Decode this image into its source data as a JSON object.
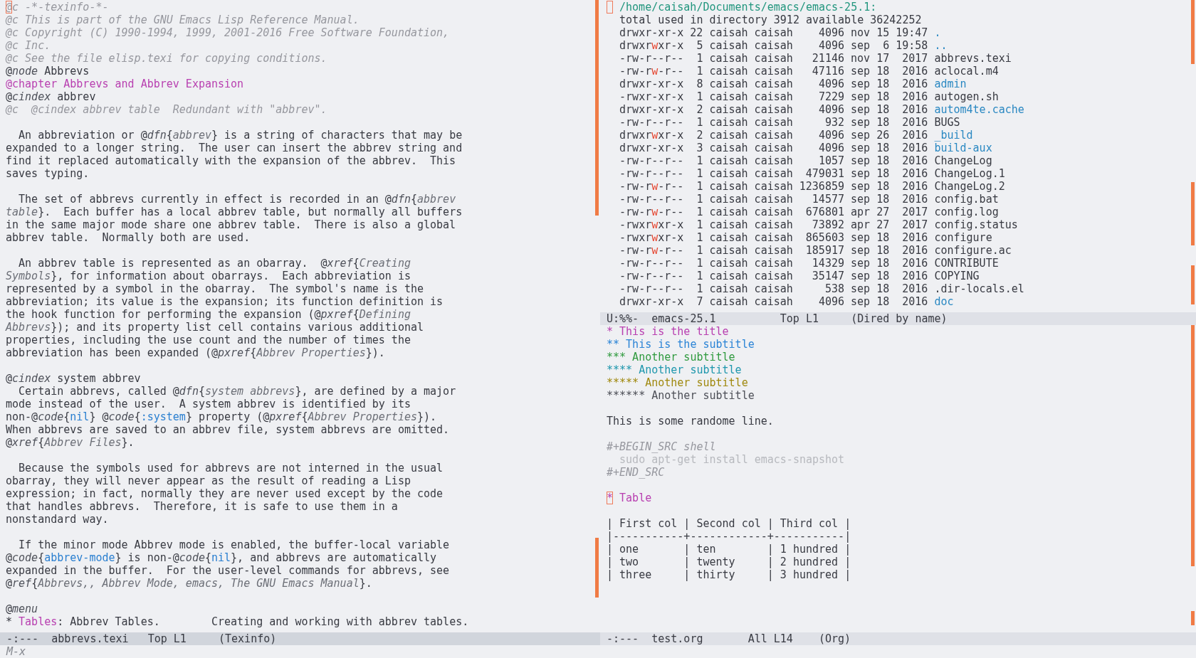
{
  "windows": [
    {
      "kind": "texinfo",
      "blocks": [
        [
          [
            {
              "text": "@c -*-texinfo-*-",
              "kind": "comment_at_cursor"
            }
          ],
          [
            {
              "text": "@c This is part of the GNU Emacs Lisp Reference Manual.",
              "kind": "comment"
            }
          ],
          [
            {
              "text": "@c Copyright (C) 1990-1994, 1999, 2001-2016 Free Software Foundation,",
              "kind": "comment"
            }
          ],
          [
            {
              "text": "@c Inc.",
              "kind": "comment"
            }
          ],
          [
            {
              "text": "@c See the file elisp.texi for copying conditions.",
              "kind": "comment"
            }
          ],
          [
            {
              "text": "@"
            },
            {
              "text": "node",
              "kind": "keyword"
            },
            {
              "text": " Abbrevs"
            }
          ],
          [
            {
              "text": "@chapter Abbrevs and Abbrev Expansion",
              "kind": "chapter"
            }
          ],
          [
            {
              "text": "@"
            },
            {
              "text": "cindex",
              "kind": "keyword"
            },
            {
              "text": " abbrev"
            }
          ],
          [
            {
              "text": "@c  @cindex abbrev table  Redundant with \"abbrev\".",
              "kind": "comment"
            }
          ]
        ],
        [
          [
            {
              "text": "  An abbreviation or @"
            },
            {
              "text": "dfn",
              "kind": "keyword"
            },
            {
              "text": "{"
            },
            {
              "text": "abbrev",
              "kind": "argument"
            },
            {
              "text": "} is a string of characters that may be"
            }
          ],
          [
            {
              "text": "expanded to a longer string.  The user can insert the abbrev string and"
            }
          ],
          [
            {
              "text": "find it replaced automatically with the expansion of the abbrev.  This"
            }
          ],
          [
            {
              "text": "saves typing."
            }
          ]
        ],
        [
          [
            {
              "text": "  The set of abbrevs currently in effect is recorded in an @"
            },
            {
              "text": "dfn",
              "kind": "keyword"
            },
            {
              "text": "{"
            },
            {
              "text": "abbrev",
              "kind": "argument"
            }
          ],
          [
            {
              "text": "table",
              "kind": "argument"
            },
            {
              "text": "}.  Each buffer has a local abbrev table, but normally all buffers"
            }
          ],
          [
            {
              "text": "in the same major mode share one abbrev table.  There is also a global"
            }
          ],
          [
            {
              "text": "abbrev table.  Normally both are used."
            }
          ]
        ],
        [
          [
            {
              "text": "  An abbrev table is represented as an obarray.  @"
            },
            {
              "text": "xref",
              "kind": "keyword"
            },
            {
              "text": "{"
            },
            {
              "text": "Creating",
              "kind": "argument"
            }
          ],
          [
            {
              "text": "Symbols",
              "kind": "argument"
            },
            {
              "text": "}, for information about obarrays.  Each abbreviation is"
            }
          ],
          [
            {
              "text": "represented by a symbol in the obarray.  The symbol's name is the"
            }
          ],
          [
            {
              "text": "abbreviation; its value is the expansion; its function definition is"
            }
          ],
          [
            {
              "text": "the hook function for performing the expansion (@"
            },
            {
              "text": "pxref",
              "kind": "keyword"
            },
            {
              "text": "{"
            },
            {
              "text": "Defining",
              "kind": "argument"
            }
          ],
          [
            {
              "text": "Abbrevs",
              "kind": "argument"
            },
            {
              "text": "}); and its property list cell contains various additional"
            }
          ],
          [
            {
              "text": "properties, including the use count and the number of times the"
            }
          ],
          [
            {
              "text": "abbreviation has been expanded (@"
            },
            {
              "text": "pxref",
              "kind": "keyword"
            },
            {
              "text": "{"
            },
            {
              "text": "Abbrev Properties",
              "kind": "argument"
            },
            {
              "text": "})."
            }
          ]
        ],
        [
          [
            {
              "text": "@"
            },
            {
              "text": "cindex",
              "kind": "keyword"
            },
            {
              "text": " system abbrev"
            }
          ],
          [
            {
              "text": "  Certain abbrevs, called @"
            },
            {
              "text": "dfn",
              "kind": "keyword"
            },
            {
              "text": "{"
            },
            {
              "text": "system abbrevs",
              "kind": "argument"
            },
            {
              "text": "}, are defined by a major"
            }
          ],
          [
            {
              "text": "mode instead of the user.  A system abbrev is identified by its"
            }
          ],
          [
            {
              "text": "non-@"
            },
            {
              "text": "code",
              "kind": "keyword"
            },
            {
              "text": "{"
            },
            {
              "text": "nil",
              "kind": "code"
            },
            {
              "text": "} @"
            },
            {
              "text": "code",
              "kind": "keyword"
            },
            {
              "text": "{"
            },
            {
              "text": ":system",
              "kind": "code"
            },
            {
              "text": "} property (@"
            },
            {
              "text": "pxref",
              "kind": "keyword"
            },
            {
              "text": "{"
            },
            {
              "text": "Abbrev Properties",
              "kind": "argument"
            },
            {
              "text": "})."
            }
          ],
          [
            {
              "text": "When abbrevs are saved to an abbrev file, system abbrevs are omitted."
            }
          ],
          [
            {
              "text": "@"
            },
            {
              "text": "xref",
              "kind": "keyword"
            },
            {
              "text": "{"
            },
            {
              "text": "Abbrev Files",
              "kind": "argument"
            },
            {
              "text": "}."
            }
          ]
        ],
        [
          [
            {
              "text": "  Because the symbols used for abbrevs are not interned in the usual"
            }
          ],
          [
            {
              "text": "obarray, they will never appear as the result of reading a Lisp"
            }
          ],
          [
            {
              "text": "expression; in fact, normally they are never used except by the code"
            }
          ],
          [
            {
              "text": "that handles abbrevs.  Therefore, it is safe to use them in a"
            }
          ],
          [
            {
              "text": "nonstandard way."
            }
          ]
        ],
        [
          [
            {
              "text": "  If the minor mode Abbrev mode is enabled, the buffer-local variable"
            }
          ],
          [
            {
              "text": "@"
            },
            {
              "text": "code",
              "kind": "keyword"
            },
            {
              "text": "{"
            },
            {
              "text": "abbrev-mode",
              "kind": "code"
            },
            {
              "text": "} is non-@"
            },
            {
              "text": "code",
              "kind": "keyword"
            },
            {
              "text": "{"
            },
            {
              "text": "nil",
              "kind": "code"
            },
            {
              "text": "}, and abbrevs are automatically"
            }
          ],
          [
            {
              "text": "expanded in the buffer.  For the user-level commands for abbrevs, see"
            }
          ],
          [
            {
              "text": "@"
            },
            {
              "text": "ref",
              "kind": "keyword"
            },
            {
              "text": "{"
            },
            {
              "text": "Abbrevs,, Abbrev Mode, emacs, The GNU Emacs Manual",
              "kind": "argument"
            },
            {
              "text": "}."
            }
          ]
        ],
        [
          [
            {
              "text": "@"
            },
            {
              "text": "menu",
              "kind": "keyword"
            }
          ],
          [
            {
              "text": "* "
            },
            {
              "text": "Tables",
              "kind": "menu"
            },
            {
              "text": ": Abbrev Tables.        Creating and working with abbrev tables."
            }
          ]
        ]
      ],
      "mode_line": {
        "active": true,
        "status": "-:---",
        "buffer": "abbrevs.texi",
        "position": "Top L1",
        "mode": "(Texinfo)"
      }
    },
    {
      "kind": "dired",
      "header": {
        "cursor": true,
        "path": "/home/caisah/Documents/emacs/emacs-25.1:"
      },
      "summary": "total used in directory 3912 available 36242252",
      "entries": [
        {
          "kind": "directory",
          "permissions": "drwxr-xr-x",
          "group_writable": false,
          "links": "22",
          "owner": "caisah",
          "group": "caisah",
          "size": "4096",
          "date": "nov 15 19:47",
          "name": "."
        },
        {
          "kind": "directory",
          "permissions": "drwxrwxr-x",
          "group_writable": true,
          "links": "5",
          "owner": "caisah",
          "group": "caisah",
          "size": "4096",
          "date": "sep  6 19:58",
          "name": ".."
        },
        {
          "kind": "file",
          "permissions": "-rw-r--r--",
          "group_writable": false,
          "links": "1",
          "owner": "caisah",
          "group": "caisah",
          "size": "21146",
          "date": "nov 17  2017",
          "name": "abbrevs.texi"
        },
        {
          "kind": "file",
          "permissions": "-rw-rw-r--",
          "group_writable": true,
          "links": "1",
          "owner": "caisah",
          "group": "caisah",
          "size": "47116",
          "date": "sep 18  2016",
          "name": "aclocal.m4"
        },
        {
          "kind": "directory",
          "permissions": "drwxr-xr-x",
          "group_writable": false,
          "links": "8",
          "owner": "caisah",
          "group": "caisah",
          "size": "4096",
          "date": "sep 18  2016",
          "name": "admin"
        },
        {
          "kind": "file",
          "permissions": "-rwxr-xr-x",
          "group_writable": false,
          "links": "1",
          "owner": "caisah",
          "group": "caisah",
          "size": "7229",
          "date": "sep 18  2016",
          "name": "autogen.sh"
        },
        {
          "kind": "directory",
          "permissions": "drwxr-xr-x",
          "group_writable": false,
          "links": "2",
          "owner": "caisah",
          "group": "caisah",
          "size": "4096",
          "date": "sep 18  2016",
          "name": "autom4te.cache"
        },
        {
          "kind": "file",
          "permissions": "-rw-r--r--",
          "group_writable": false,
          "links": "1",
          "owner": "caisah",
          "group": "caisah",
          "size": "932",
          "date": "sep 18  2016",
          "name": "BUGS"
        },
        {
          "kind": "directory",
          "permissions": "drwxrwxr-x",
          "group_writable": true,
          "links": "2",
          "owner": "caisah",
          "group": "caisah",
          "size": "4096",
          "date": "sep 26  2016",
          "name": "_build"
        },
        {
          "kind": "directory",
          "permissions": "drwxr-xr-x",
          "group_writable": false,
          "links": "3",
          "owner": "caisah",
          "group": "caisah",
          "size": "4096",
          "date": "sep 18  2016",
          "name": "build-aux"
        },
        {
          "kind": "file",
          "permissions": "-rw-r--r--",
          "group_writable": false,
          "links": "1",
          "owner": "caisah",
          "group": "caisah",
          "size": "1057",
          "date": "sep 18  2016",
          "name": "ChangeLog"
        },
        {
          "kind": "file",
          "permissions": "-rw-r--r--",
          "group_writable": false,
          "links": "1",
          "owner": "caisah",
          "group": "caisah",
          "size": "479031",
          "date": "sep 18  2016",
          "name": "ChangeLog.1"
        },
        {
          "kind": "file",
          "permissions": "-rw-rw-r--",
          "group_writable": true,
          "links": "1",
          "owner": "caisah",
          "group": "caisah",
          "size": "1236859",
          "date": "sep 18  2016",
          "name": "ChangeLog.2"
        },
        {
          "kind": "file",
          "permissions": "-rw-r--r--",
          "group_writable": false,
          "links": "1",
          "owner": "caisah",
          "group": "caisah",
          "size": "14577",
          "date": "sep 18  2016",
          "name": "config.bat"
        },
        {
          "kind": "file",
          "permissions": "-rw-rw-r--",
          "group_writable": true,
          "links": "1",
          "owner": "caisah",
          "group": "caisah",
          "size": "676801",
          "date": "apr 27  2017",
          "name": "config.log"
        },
        {
          "kind": "file",
          "permissions": "-rwxrwxr-x",
          "group_writable": true,
          "links": "1",
          "owner": "caisah",
          "group": "caisah",
          "size": "73892",
          "date": "apr 27  2017",
          "name": "config.status"
        },
        {
          "kind": "file",
          "permissions": "-rwxrwxr-x",
          "group_writable": true,
          "links": "1",
          "owner": "caisah",
          "group": "caisah",
          "size": "865603",
          "date": "sep 18  2016",
          "name": "configure"
        },
        {
          "kind": "file",
          "permissions": "-rw-rw-r--",
          "group_writable": true,
          "links": "1",
          "owner": "caisah",
          "group": "caisah",
          "size": "185917",
          "date": "sep 18  2016",
          "name": "configure.ac"
        },
        {
          "kind": "file",
          "permissions": "-rw-r--r--",
          "group_writable": false,
          "links": "1",
          "owner": "caisah",
          "group": "caisah",
          "size": "14329",
          "date": "sep 18  2016",
          "name": "CONTRIBUTE"
        },
        {
          "kind": "file",
          "permissions": "-rw-r--r--",
          "group_writable": false,
          "links": "1",
          "owner": "caisah",
          "group": "caisah",
          "size": "35147",
          "date": "sep 18  2016",
          "name": "COPYING"
        },
        {
          "kind": "file",
          "permissions": "-rw-r--r--",
          "group_writable": false,
          "links": "1",
          "owner": "caisah",
          "group": "caisah",
          "size": "538",
          "date": "sep 18  2016",
          "name": ".dir-locals.el"
        },
        {
          "kind": "directory",
          "permissions": "drwxr-xr-x",
          "group_writable": false,
          "links": "7",
          "owner": "caisah",
          "group": "caisah",
          "size": "4096",
          "date": "sep 18  2016",
          "name": "doc"
        }
      ],
      "mode_line": {
        "active": false,
        "status": "U:%%-",
        "buffer": "emacs-25.1",
        "position": "Top L1",
        "mode": "(Dired by name)"
      }
    },
    {
      "kind": "org",
      "blocks": [
        [
          {
            "kind": "heading",
            "text": "* This is the title",
            "color": "#b83fb0",
            "cursor": false
          },
          {
            "kind": "heading",
            "text": "** This is the subtitle",
            "color": "#2b84d6",
            "cursor": false
          },
          {
            "kind": "heading",
            "text": "*** Another subtitle",
            "color": "#2f9a3e",
            "cursor": false
          },
          {
            "kind": "heading",
            "text": "**** Another subtitle",
            "color": "#1f97ad",
            "cursor": false
          },
          {
            "kind": "heading",
            "text": "***** Another subtitle",
            "color": "#a0890f",
            "cursor": false
          },
          {
            "kind": "heading",
            "text": "****** Another subtitle",
            "color": "#4e5058",
            "cursor": false
          }
        ],
        [
          {
            "kind": "text",
            "text": "This is some randome line.",
            "cursor": false
          }
        ],
        [
          {
            "kind": "src_delimiter",
            "text": "#+BEGIN_SRC shell",
            "cursor": false
          },
          {
            "kind": "src_code",
            "text": "  sudo apt-get install emacs-snapshot",
            "cursor": false
          },
          {
            "kind": "src_delimiter",
            "text": "#+END_SRC",
            "cursor": false
          }
        ],
        [
          {
            "kind": "heading",
            "text": "* Table",
            "color": "#b83fb0",
            "cursor": true
          }
        ],
        [
          {
            "kind": "table_row",
            "text": "| First col | Second col | Third col |",
            "cursor": false
          },
          {
            "kind": "table_rule",
            "text": "|-----------+------------+-----------|",
            "cursor": false
          },
          {
            "kind": "table_row",
            "text": "| one       | ten        | 1 hundred |",
            "cursor": false
          },
          {
            "kind": "table_row",
            "text": "| two       | twenty     | 2 hundred |",
            "cursor": false
          },
          {
            "kind": "table_row",
            "text": "| three     | thirty     | 3 hundred |",
            "cursor": false
          }
        ]
      ],
      "mode_line": {
        "active": false,
        "status": "-:---",
        "buffer": "test.org",
        "position": "All L14",
        "mode": "(Org)"
      }
    }
  ],
  "minibuffer": {
    "prompt": "M-x"
  }
}
